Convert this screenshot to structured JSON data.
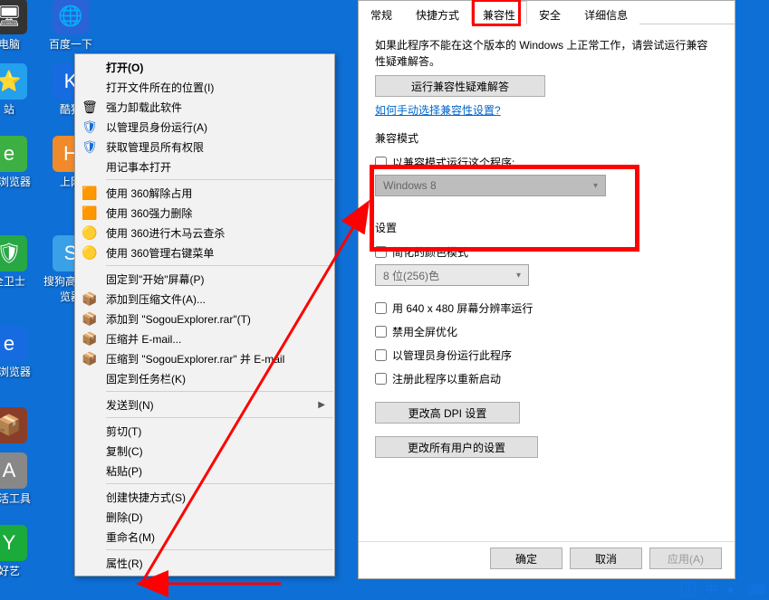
{
  "desktop": {
    "icons": [
      {
        "label": "电脑",
        "color": "#333"
      },
      {
        "label": "百度一下",
        "color": "#2a62d8"
      },
      {
        "label": "站",
        "color": "#24a0ed"
      },
      {
        "label": "酷狗",
        "color": "#176be0"
      },
      {
        "label": "全浏览器",
        "color": "#3cb043"
      },
      {
        "label": "上网",
        "color": "#f08a2a"
      },
      {
        "label": "全卫士",
        "color": "#28a745"
      },
      {
        "label": "搜狗高速浏览器",
        "color": "#3aa0e8"
      },
      {
        "label": "速浏览器",
        "color": "#176be0"
      },
      {
        "label": "",
        "color": "#8a3e2a"
      },
      {
        "label": "激活工具",
        "color": "#888"
      },
      {
        "label": "好艺",
        "color": "#1aab3a"
      }
    ]
  },
  "context_menu": {
    "items": [
      {
        "label": "打开(O)",
        "bold": true
      },
      {
        "label": "打开文件所在的位置(I)"
      },
      {
        "label": "强力卸载此软件",
        "icon": "🗑"
      },
      {
        "label": "以管理员身份运行(A)",
        "icon": "🛡"
      },
      {
        "label": "获取管理员所有权限",
        "icon": "🛡"
      },
      {
        "label": "用记事本打开"
      },
      {
        "sep": true
      },
      {
        "label": "使用 360解除占用",
        "icon": "🟧"
      },
      {
        "label": "使用 360强力删除",
        "icon": "🟧"
      },
      {
        "label": "使用 360进行木马云查杀",
        "icon": "🟡"
      },
      {
        "label": "使用 360管理右键菜单",
        "icon": "🟡"
      },
      {
        "sep": true
      },
      {
        "label": "固定到\"开始\"屏幕(P)"
      },
      {
        "label": "添加到压缩文件(A)...",
        "icon": "📦"
      },
      {
        "label": "添加到 \"SogouExplorer.rar\"(T)",
        "icon": "📦"
      },
      {
        "label": "压缩并 E-mail...",
        "icon": "📦"
      },
      {
        "label": "压缩到 \"SogouExplorer.rar\" 并 E-mail",
        "icon": "📦"
      },
      {
        "label": "固定到任务栏(K)"
      },
      {
        "sep": true
      },
      {
        "label": "发送到(N)",
        "arrow": true
      },
      {
        "sep": true
      },
      {
        "label": "剪切(T)"
      },
      {
        "label": "复制(C)"
      },
      {
        "label": "粘贴(P)"
      },
      {
        "sep": true
      },
      {
        "label": "创建快捷方式(S)"
      },
      {
        "label": "删除(D)"
      },
      {
        "label": "重命名(M)"
      },
      {
        "sep": true
      },
      {
        "label": "属性(R)"
      }
    ]
  },
  "dialog": {
    "tabs": [
      "常规",
      "快捷方式",
      "兼容性",
      "安全",
      "详细信息"
    ],
    "active_tab": 2,
    "intro": "如果此程序不能在这个版本的 Windows 上正常工作，请尝试运行兼容性疑难解答。",
    "troubleshoot_btn": "运行兼容性疑难解答",
    "manual_link": "如何手动选择兼容性设置?",
    "compat_mode_header": "兼容模式",
    "compat_mode_check": "以兼容模式运行这个程序:",
    "compat_mode_value": "Windows 8",
    "settings_header": "设置",
    "settings": {
      "reduced_color": "简化的颜色模式",
      "color_combo": "8 位(256)色",
      "res640": "用 640 x 480 屏幕分辨率运行",
      "disable_fullscreen": "禁用全屏优化",
      "run_as_admin": "以管理员身份运行此程序",
      "register_restart": "注册此程序以重新启动"
    },
    "dpi_btn": "更改高 DPI 设置",
    "all_users_btn": "更改所有用户的设置",
    "ok": "确定",
    "cancel": "取消",
    "apply": "应用(A)"
  },
  "ime": {
    "a": "王",
    "b": "中",
    "c": "●,",
    "d": "⌨"
  }
}
